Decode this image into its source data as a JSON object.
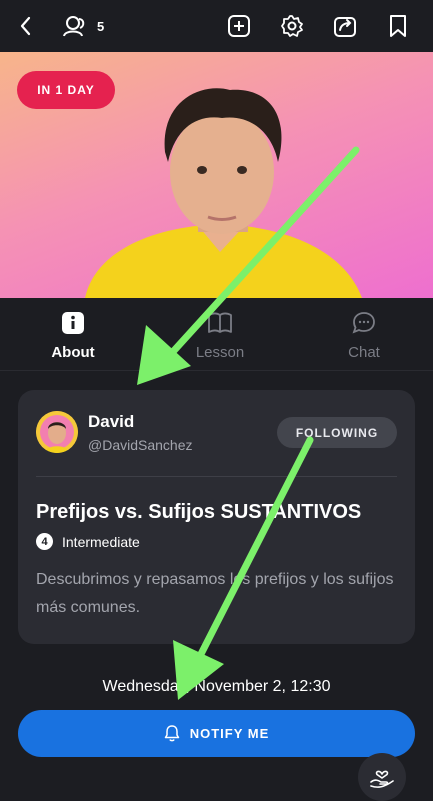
{
  "header": {
    "participant_count": "5"
  },
  "hero": {
    "badge": "IN 1 DAY"
  },
  "tabs": [
    {
      "label": "About",
      "icon": "info-icon"
    },
    {
      "label": "Lesson",
      "icon": "book-icon"
    },
    {
      "label": "Chat",
      "icon": "chat-bubble-icon"
    }
  ],
  "card": {
    "author_name": "David",
    "author_handle": "@DavidSanchez",
    "follow_label": "FOLLOWING",
    "title": "Prefijos vs. Sufijos SUSTANTIVOS",
    "level_number": "4",
    "level_label": "Intermediate",
    "description": "Descubrimos y repasamos los prefijos y los sufijos más comunes."
  },
  "schedule": {
    "datetime": "Wednesday, November 2, 12:30"
  },
  "actions": {
    "notify_label": "NOTIFY ME"
  },
  "colors": {
    "background": "#1c1d22",
    "card": "#2b2c33",
    "badge": "#e5224f",
    "primary": "#1972e0",
    "annotation_arrow": "#7cf06a"
  }
}
